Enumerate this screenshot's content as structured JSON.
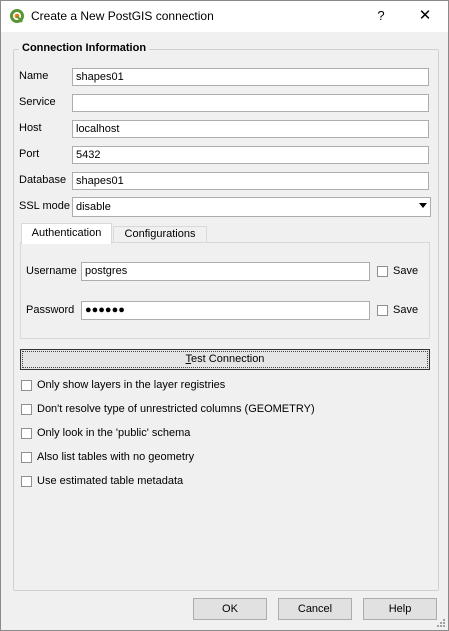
{
  "window": {
    "title": "Create a New PostGIS connection",
    "help_glyph": "?",
    "close_glyph": "✕",
    "app_icon": "qgis-icon"
  },
  "group": {
    "title": "Connection Information"
  },
  "fields": {
    "name": {
      "label": "Name",
      "value": "shapes01"
    },
    "service": {
      "label": "Service",
      "value": ""
    },
    "host": {
      "label": "Host",
      "value": "localhost"
    },
    "port": {
      "label": "Port",
      "value": "5432"
    },
    "database": {
      "label": "Database",
      "value": "shapes01"
    },
    "ssl": {
      "label": "SSL mode",
      "value": "disable"
    }
  },
  "tabs": [
    {
      "label": "Authentication",
      "active": true
    },
    {
      "label": "Configurations",
      "active": false
    }
  ],
  "auth": {
    "username_label": "Username",
    "username_value": "postgres",
    "password_label": "Password",
    "password_value": "●●●●●●",
    "save_label": "Save"
  },
  "test_button": {
    "prefix": "T",
    "rest": "est Connection"
  },
  "options": [
    "Only show layers in the layer registries",
    "Don't resolve type of unrestricted columns (GEOMETRY)",
    "Only look in the 'public' schema",
    "Also list tables with no geometry",
    "Use estimated table metadata"
  ],
  "buttons": {
    "ok": "OK",
    "cancel": "Cancel",
    "help": "Help"
  }
}
